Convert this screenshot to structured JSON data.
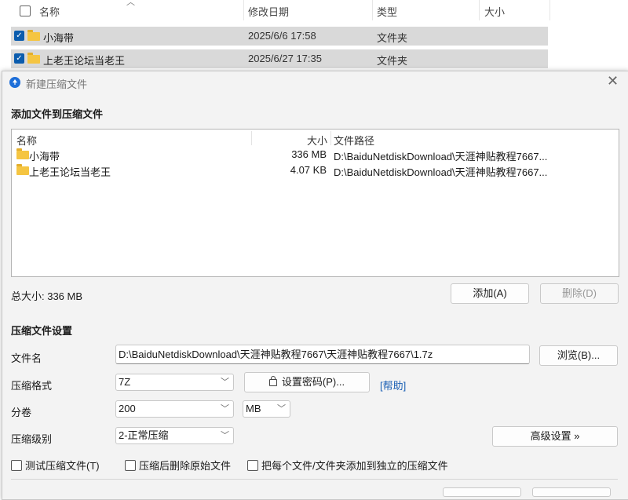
{
  "explorer": {
    "columns": {
      "name": "名称",
      "modified": "修改日期",
      "type": "类型",
      "size": "大小"
    },
    "rows": [
      {
        "name": "小海带",
        "modified": "2025/6/6 17:58",
        "type": "文件夹"
      },
      {
        "name": "上老王论坛当老王",
        "modified": "2025/6/27 17:35",
        "type": "文件夹"
      }
    ]
  },
  "dialog": {
    "title": "新建压缩文件",
    "add_section_title": "添加文件到压缩文件",
    "list": {
      "headers": {
        "name": "名称",
        "size": "大小",
        "path": "文件路径"
      },
      "rows": [
        {
          "name": "小海带",
          "size": "336 MB",
          "path": "D:\\BaiduNetdiskDownload\\天涯神贴教程7667..."
        },
        {
          "name": "上老王论坛当老王",
          "size": "4.07 KB",
          "path": "D:\\BaiduNetdiskDownload\\天涯神贴教程7667..."
        }
      ]
    },
    "total_size": "总大小: 336 MB",
    "add_button": "添加(A)",
    "delete_button": "删除(D)",
    "settings_title": "压缩文件设置",
    "filename_label": "文件名",
    "filename_value": "D:\\BaiduNetdiskDownload\\天涯神贴教程7667\\天涯神贴教程7667\\1.7z",
    "browse_button": "浏览(B)...",
    "format_label": "压缩格式",
    "format_value": "7Z",
    "password_button": "设置密码(P)...",
    "help_link": "[帮助]",
    "volume_label": "分卷",
    "volume_value": "200",
    "volume_unit": "MB",
    "level_label": "压缩级别",
    "level_value": "2-正常压缩",
    "advanced_button": "高级设置 »",
    "options": {
      "test": "测试压缩文件(T)",
      "delete_after": "压缩后删除原始文件",
      "separate": "把每个文件/文件夹添加到独立的压缩文件"
    }
  }
}
